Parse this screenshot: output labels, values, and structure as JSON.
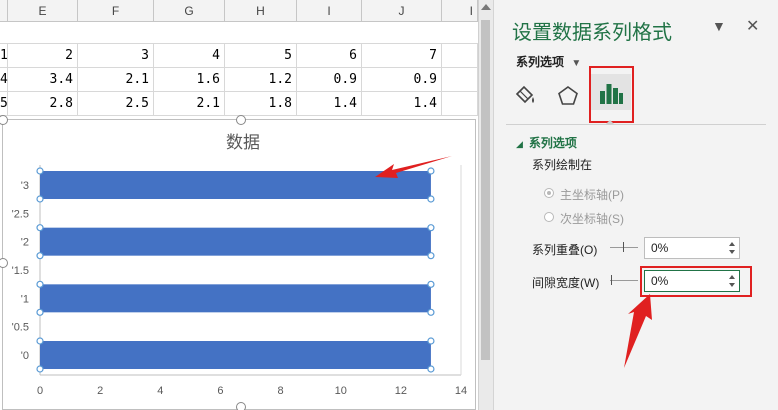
{
  "sheet": {
    "columns": [
      "E",
      "F",
      "G",
      "H",
      "I",
      "J",
      "I"
    ],
    "rows": [
      {
        "lead": "1",
        "cells": [
          "2",
          "3",
          "4",
          "5",
          "6",
          "7"
        ]
      },
      {
        "lead": "4",
        "cells": [
          "3.4",
          "2.1",
          "1.6",
          "1.2",
          "0.9",
          "0.9"
        ]
      },
      {
        "lead": "5",
        "cells": [
          "2.8",
          "2.5",
          "2.1",
          "1.8",
          "1.4",
          "1.4"
        ]
      }
    ]
  },
  "chart_data": {
    "type": "bar",
    "orientation": "horizontal",
    "title": "数据",
    "categories": [
      "'0",
      "'0.5",
      "'1",
      "'1.5",
      "'2",
      "'2.5",
      "'3"
    ],
    "series": [
      {
        "values": [
          13,
          13,
          13,
          13
        ]
      }
    ],
    "bar_categories": [
      "'0",
      "'1",
      "'2",
      "'3"
    ],
    "x_ticks": [
      "0",
      "2",
      "4",
      "6",
      "8",
      "10",
      "12",
      "14"
    ],
    "xlim": [
      0,
      14
    ],
    "bar_color": "#4472c4",
    "grid": false
  },
  "panel": {
    "title": "设置数据系列格式",
    "tab_menu": "系列选项",
    "section": "系列选项",
    "plot_on_label": "系列绘制在",
    "primary_axis": "主坐标轴(P)",
    "secondary_axis": "次坐标轴(S)",
    "overlap_label": "系列重叠(O)",
    "overlap_value": "0%",
    "gap_label": "间隙宽度(W)",
    "gap_value": "0%",
    "accent": "#217346",
    "highlight": "#e02020",
    "icons": [
      "paint-bucket-icon",
      "pentagon-icon",
      "bar-chart-icon"
    ]
  }
}
